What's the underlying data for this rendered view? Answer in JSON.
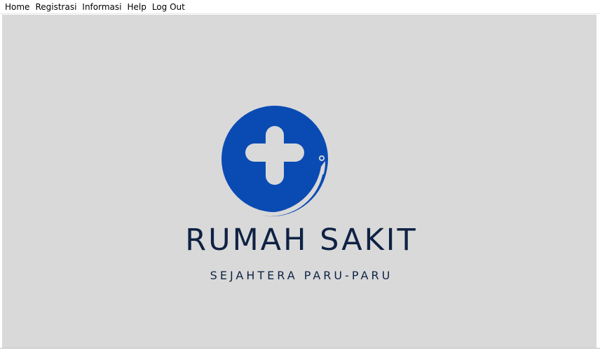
{
  "menubar": {
    "items": [
      {
        "label": "Home"
      },
      {
        "label": "Registrasi"
      },
      {
        "label": "Informasi"
      },
      {
        "label": "Help"
      },
      {
        "label": "Log Out"
      }
    ]
  },
  "main": {
    "logo": {
      "icon": "medical-cross-icon",
      "circle_color": "#0a4bb3",
      "cross_color": "#d9d9d9"
    },
    "title": "RUMAH SAKIT",
    "subtitle": "SEJAHTERA PARU-PARU",
    "text_color": "#0f2244",
    "background_color": "#d9d9d9"
  }
}
